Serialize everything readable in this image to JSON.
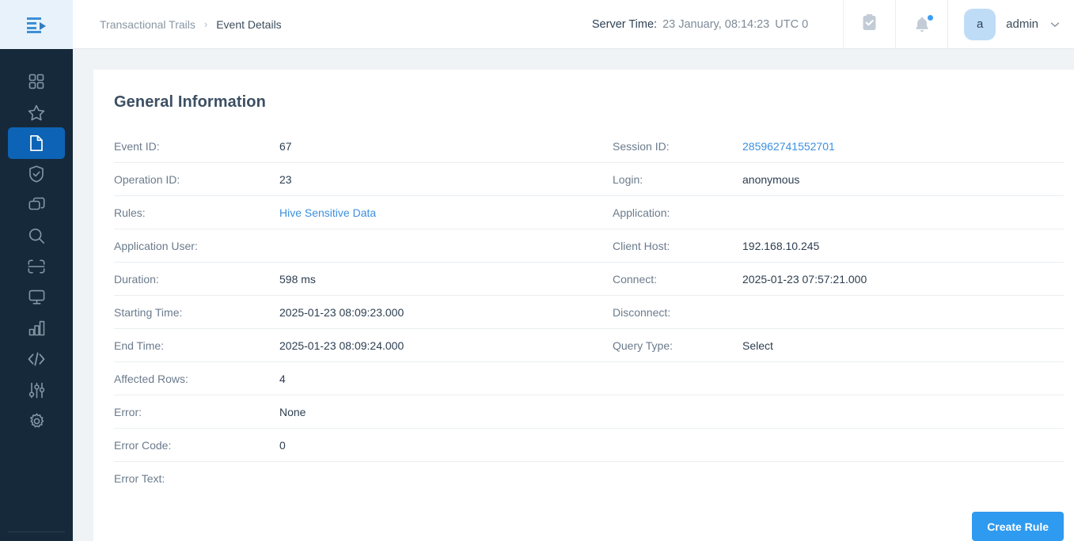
{
  "colors": {
    "sidebar_bg": "#16293a",
    "sidebar_active": "#0d63b5",
    "logo_bg": "#e8f2fb",
    "page_bg": "#eff3f6",
    "card_bg": "#ffffff",
    "accent_blue": "#2e9af0",
    "link_blue": "#3b90e0",
    "avatar_bg": "#bfdcf7",
    "label_grey": "#6b7b8c",
    "value_dark": "#2d3e50"
  },
  "sidebar": {
    "logo": "menu-play-logo",
    "items": [
      {
        "name": "dashboard",
        "icon": "grid-icon",
        "active": false
      },
      {
        "name": "favorites",
        "icon": "star-icon",
        "active": false
      },
      {
        "name": "reports",
        "icon": "document-icon",
        "active": true
      },
      {
        "name": "security",
        "icon": "shield-check-icon",
        "active": false
      },
      {
        "name": "layers",
        "icon": "layers-icon",
        "active": false
      },
      {
        "name": "discovery",
        "icon": "search-icon",
        "active": false
      },
      {
        "name": "scan",
        "icon": "scan-frame-icon",
        "active": false
      },
      {
        "name": "monitoring",
        "icon": "monitor-icon",
        "active": false
      },
      {
        "name": "analytics",
        "icon": "bar-chart-icon",
        "active": false
      },
      {
        "name": "developer",
        "icon": "code-icon",
        "active": false
      },
      {
        "name": "configuration",
        "icon": "sliders-icon",
        "active": false
      },
      {
        "name": "settings",
        "icon": "gear-icon",
        "active": false
      }
    ]
  },
  "topbar": {
    "breadcrumb": {
      "root": "Transactional Trails",
      "separator": "›",
      "current": "Event Details"
    },
    "server_time": {
      "label": "Server Time:",
      "value": "23 January, 08:14:23",
      "timezone": "UTC 0"
    },
    "tasks_icon": "clipboard-check-icon",
    "notifications_icon": "bell-icon",
    "notification_badge": true,
    "user": {
      "avatar_initial": "a",
      "name": "admin",
      "chevron": "⌄"
    }
  },
  "main": {
    "card_title": "General Information",
    "rows": [
      {
        "left": {
          "label": "Event ID:",
          "value": "67",
          "link": false
        },
        "right": {
          "label": "Session ID:",
          "value": "285962741552701",
          "link": true
        }
      },
      {
        "left": {
          "label": "Operation ID:",
          "value": "23",
          "link": false
        },
        "right": {
          "label": "Login:",
          "value": "anonymous",
          "link": false
        }
      },
      {
        "left": {
          "label": "Rules:",
          "value": "Hive Sensitive Data",
          "link": true
        },
        "right": {
          "label": "Application:",
          "value": "",
          "link": false
        }
      },
      {
        "left": {
          "label": "Application User:",
          "value": "",
          "link": false
        },
        "right": {
          "label": "Client Host:",
          "value": "192.168.10.245",
          "link": false
        }
      },
      {
        "left": {
          "label": "Duration:",
          "value": "598 ms",
          "link": false
        },
        "right": {
          "label": "Connect:",
          "value": "2025-01-23 07:57:21.000",
          "link": false
        }
      },
      {
        "left": {
          "label": "Starting Time:",
          "value": "2025-01-23 08:09:23.000",
          "link": false
        },
        "right": {
          "label": "Disconnect:",
          "value": "",
          "link": false
        }
      },
      {
        "left": {
          "label": "End Time:",
          "value": "2025-01-23 08:09:24.000",
          "link": false
        },
        "right": {
          "label": "Query Type:",
          "value": "Select",
          "link": false
        }
      }
    ],
    "full_rows": [
      {
        "label": "Affected Rows:",
        "value": "4",
        "link": false
      },
      {
        "label": "Error:",
        "value": "None",
        "link": false
      },
      {
        "label": "Error Code:",
        "value": "0",
        "link": false
      },
      {
        "label": "Error Text:",
        "value": "",
        "link": false
      }
    ],
    "create_rule_button": "Create Rule"
  }
}
